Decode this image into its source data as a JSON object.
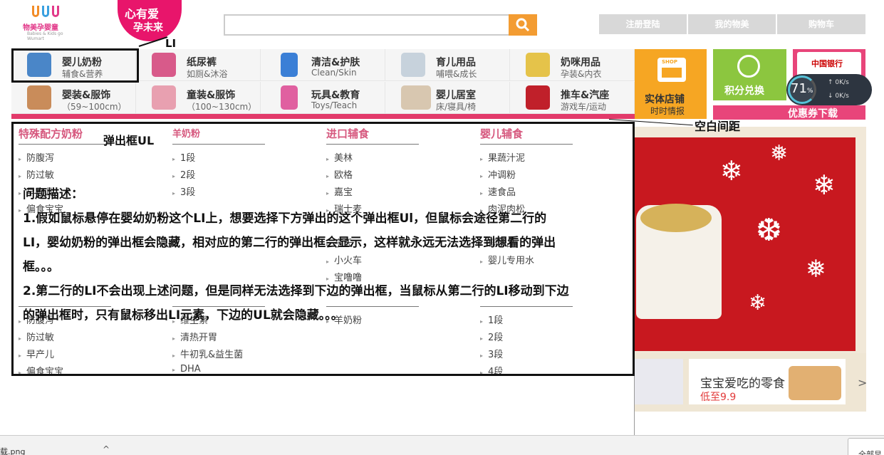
{
  "header": {
    "logo_name": "物美孕婴童",
    "logo_sub": "Babies & Kids go Wumart",
    "slogan_line1": "心有爱",
    "slogan_line2": "孕未来",
    "search_value": "",
    "top_nav": [
      "注册登陆",
      "我的物美",
      "购物车"
    ]
  },
  "categories": [
    {
      "title": "婴儿奶粉",
      "sub": "辅食&营养",
      "color": "#4a86c8"
    },
    {
      "title": "纸尿裤",
      "sub": "如厕&沐浴",
      "color": "#d85a8a"
    },
    {
      "title": "清洁&护肤",
      "sub": "Clean/Skin",
      "color": "#3b7fd6"
    },
    {
      "title": "育儿用品",
      "sub": "哺喂&成长",
      "color": "#c7d2dc"
    },
    {
      "title": "奶咪用品",
      "sub": "孕装&内衣",
      "color": "#e5c34a"
    },
    {
      "title": "婴装&服饰",
      "sub": "（59~100cm）",
      "color": "#c98c5a"
    },
    {
      "title": "童装&服饰",
      "sub": "（100~130cm）",
      "color": "#e8a0b0"
    },
    {
      "title": "玩具&教育",
      "sub": "Toys/Teach",
      "color": "#e060a0"
    },
    {
      "title": "婴儿居室",
      "sub": "床/寝具/椅",
      "color": "#d8c7b0"
    },
    {
      "title": "推车&汽座",
      "sub": "游戏车/运动",
      "color": "#c0202a"
    }
  ],
  "promo": {
    "shop_tag": "SHOP",
    "shop_title": "实体店铺",
    "shop_sub": "时时情报",
    "points": "积分兑换",
    "bank": "中国银行",
    "coupon": "优惠券下载",
    "snack_title": "宝宝爱吃的零食",
    "snack_price": "低至9.9",
    "next_arrow": ">"
  },
  "speed_widget": {
    "percent": "71",
    "unit": "%",
    "up": "0K/s",
    "down": "0K/s"
  },
  "popup": {
    "columns_top": [
      {
        "heading": "特殊配方奶粉",
        "items": [
          "防腹泻",
          "防过敏",
          "早产儿",
          "偏食宝宝"
        ]
      },
      {
        "heading": "羊奶粉",
        "items": [
          "1段",
          "2段",
          "3段"
        ]
      },
      {
        "heading": "进口辅食",
        "items": [
          "美林",
          "欧格",
          "嘉宝",
          "瑞士麦",
          "亨氏",
          "小火车",
          "宝噜噜"
        ]
      },
      {
        "heading": "婴儿辅食",
        "items": [
          "果蔬汁泥",
          "冲调粉",
          "速食品",
          "肉泥肉松",
          "调味品",
          "婴儿专用水"
        ]
      }
    ],
    "columns_bottom": [
      {
        "heading": "",
        "items": [
          "防腹泻",
          "防过敏",
          "早产儿",
          "偏食宝宝"
        ]
      },
      {
        "heading": "",
        "items": [
          "维生素",
          "清热开胃",
          "牛初乳&益生菌",
          "DHA"
        ]
      },
      {
        "heading": "",
        "items": [
          "羊奶粉"
        ]
      },
      {
        "heading": "",
        "items": [
          "1段",
          "2段",
          "3段",
          "4段"
        ]
      }
    ]
  },
  "annotations": {
    "li_label": "LI",
    "ul_label": "弹出框UL",
    "gap_label": "空白间距",
    "desc_title": "问题描述：",
    "desc_lines": [
      "1.假如鼠标悬停在婴幼奶粉这个LI上，想要选择下方弹出的这个弹出框Ul，但鼠标会途径第二行的",
      "LI，婴幼奶粉的弹出框会隐藏，相对应的第二行的弹出框会显示，这样就永远无法选择到想看的弹出",
      "框。。。",
      "2.第二行的LI不会出现上述问题，但是同样无法选择到下边的弹出框，当鼠标从第二行的LI移动到下边",
      "的弹出框时，只有鼠标移出LI元素，下边的UL就会隐藏。。。"
    ]
  },
  "download_bar": {
    "file": "载.png",
    "chevron": "^",
    "all": "全部显"
  }
}
